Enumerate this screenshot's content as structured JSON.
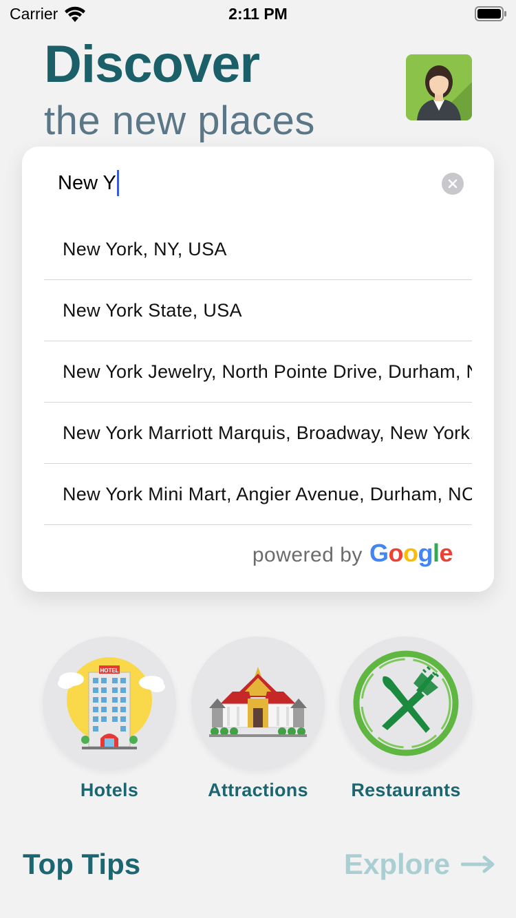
{
  "status_bar": {
    "carrier": "Carrier",
    "time": "2:11 PM"
  },
  "header": {
    "title": "Discover",
    "subtitle": "the new places"
  },
  "search": {
    "value": "New Y",
    "results": [
      "New York, NY, USA",
      "New York State, USA",
      "New York Jewelry, North Pointe Drive, Durham, NC, USA",
      "New York Marriott Marquis, Broadway, New York, NY, USA",
      "New York Mini Mart, Angier Avenue, Durham, NC, USA"
    ],
    "powered_by": "powered by",
    "google": [
      "G",
      "o",
      "o",
      "g",
      "l",
      "e"
    ]
  },
  "categories": {
    "hotels": "Hotels",
    "attractions": "Attractions",
    "restaurants": "Restaurants",
    "hotel_sign": "HOTEL"
  },
  "footer": {
    "top_tips": "Top Tips",
    "explore": "Explore"
  },
  "colors": {
    "title": "#1b5f69",
    "subtitle": "#5b7787",
    "explore": "#a9cfd2",
    "google": [
      "#4285F4",
      "#EA4335",
      "#FBBC05",
      "#4285F4",
      "#34A853",
      "#EA4335"
    ]
  }
}
